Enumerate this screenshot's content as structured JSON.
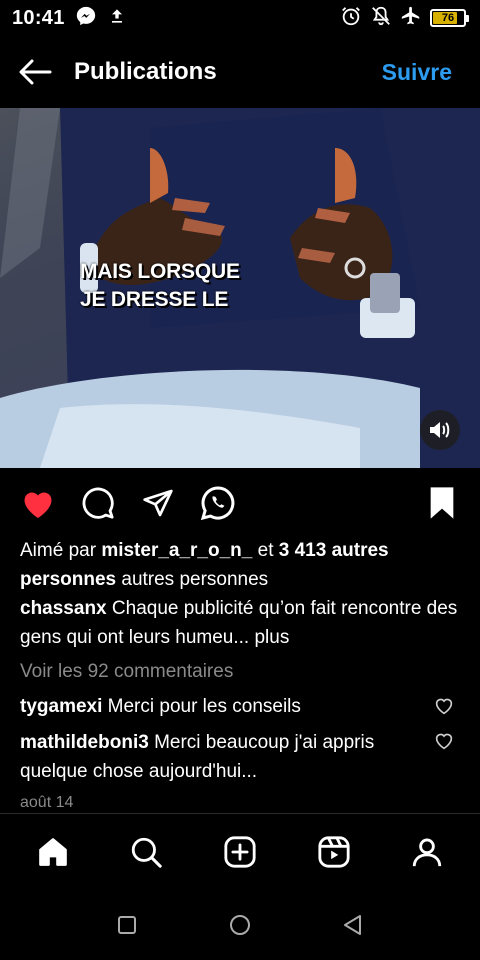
{
  "status_bar": {
    "time": "10:41",
    "battery_level": "76",
    "battery_fraction": 0.76,
    "left_icons": [
      "messenger-icon",
      "upload-icon"
    ],
    "right_icons": [
      "alarm-icon",
      "mute-icon",
      "airplane-icon",
      "battery-icon"
    ]
  },
  "header": {
    "title": "Publications",
    "follow_label": "Suivre"
  },
  "video": {
    "caption_line1": "MAIS LORSQUE",
    "caption_line2": "JE DRESSE LE"
  },
  "actions": {
    "icons": [
      "heart-icon",
      "comment-icon",
      "share-icon",
      "whatsapp-icon",
      "bookmark-icon"
    ],
    "liked_color": "#ff3040"
  },
  "post": {
    "likes_prefix": "Aimé par ",
    "likes_user": "mister_a_r_o_n_",
    "likes_middle": " et ",
    "likes_count": "3 413 autres personnes",
    "likes_suffix": " autres personnes",
    "author": "chassanx",
    "caption": " Chaque publicité qu’on fait rencontre des gens qui ont leurs humeu...",
    "more": " plus",
    "view_comments": "Voir les 92 commentaires",
    "comments": [
      {
        "user": "tygamexi",
        "text": " Merci pour les conseils"
      },
      {
        "user": "mathildeboni3",
        "text": " Merci beaucoup j'ai appris quelque chose aujourd'hui..."
      }
    ],
    "date": "août 14"
  },
  "tabbar": {
    "tabs": [
      "home-icon",
      "search-icon",
      "create-icon",
      "reels-icon",
      "profile-icon"
    ]
  },
  "navbar": {
    "buttons": [
      "recents-icon",
      "home-circle-icon",
      "back-triangle-icon"
    ]
  },
  "colors": {
    "accent": "#2d9cf0",
    "background": "#000000",
    "muted_text": "#8a8a8a",
    "battery": "#d8b000"
  }
}
